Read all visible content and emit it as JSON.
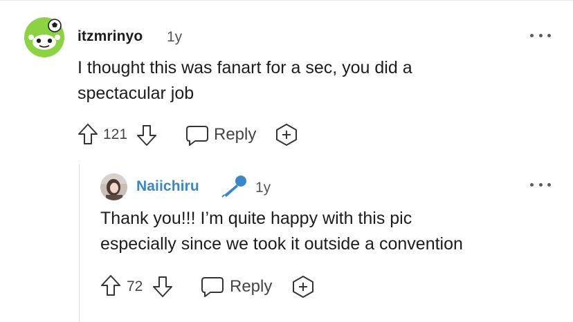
{
  "comment": {
    "author": "itzmrinyo",
    "age": "1y",
    "text_line1": "I thought this was fanart for a sec, you did a",
    "text_line2": "spectacular job",
    "votes": "121",
    "reply_label": "Reply",
    "avatar_icon": "snoo-avatar-icon"
  },
  "reply": {
    "author": "Naiichiru",
    "age": "1y",
    "badge_icon": "microphone-icon",
    "text_line1": "Thank you!!! I’m quite happy with this pic",
    "text_line2": "especially since we took it outside a convention",
    "votes": "72",
    "reply_label": "Reply"
  },
  "colors": {
    "author_link": "#3a86c9",
    "avatar_green": "#8bd341",
    "mic_blue": "#3a86c9"
  }
}
